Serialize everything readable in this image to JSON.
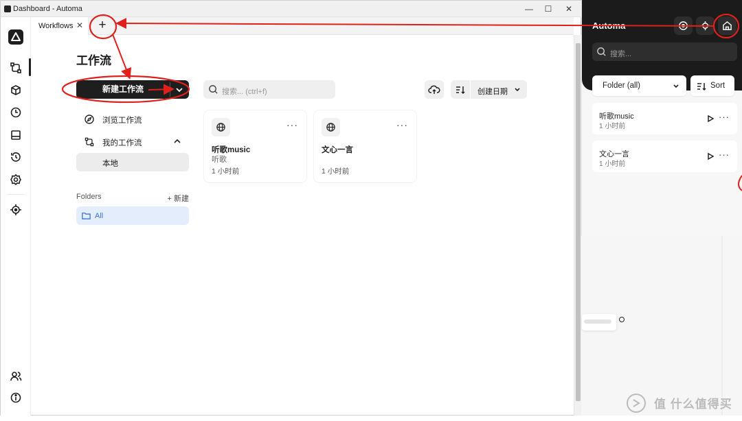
{
  "window": {
    "title": "Dashboard - Automa",
    "controls": [
      "minimize",
      "maximize",
      "close"
    ]
  },
  "tabs": [
    {
      "label": "Workflows",
      "close": "✕"
    }
  ],
  "new_tab_label": "+",
  "sidebar": {
    "icons": [
      "automa-logo-icon",
      "workflows-icon",
      "packages-icon",
      "schedule-icon",
      "storage-icon",
      "logs-icon",
      "settings-icon",
      "element-picker-icon",
      "user-icon",
      "about-icon"
    ]
  },
  "main": {
    "page_title": "工作流",
    "new_workflow_label": "新建工作流",
    "nav": {
      "browse_label": "浏览工作流",
      "my_workflows_label": "我的工作流",
      "local_label": "本地"
    },
    "folders": {
      "heading": "Folders",
      "new_label": "+ 新建",
      "all_label": "All"
    },
    "search_placeholder": "搜索... (ctrl+f)",
    "sort_label": "创建日期",
    "cards": [
      {
        "name": "听歌music",
        "description": "听歌",
        "time": "1 小时前"
      },
      {
        "name": "文心一言",
        "description": "",
        "time": "1 小时前"
      }
    ]
  },
  "popup": {
    "title": "Automa",
    "search_placeholder": "搜索...",
    "folder_select": "Folder (all)",
    "sort_label": "Sort",
    "items": [
      {
        "name": "听歌music",
        "time": "1 小时前"
      },
      {
        "name": "文心一言",
        "time": "1 小时前"
      }
    ]
  },
  "watermark": "值 什么值得买",
  "annotation_color": "#e0201b",
  "accent_colors": {
    "dark": "#1e1e1e",
    "folder_active_text": "#3b73d8",
    "folder_active_bg": "#e4edfb"
  }
}
